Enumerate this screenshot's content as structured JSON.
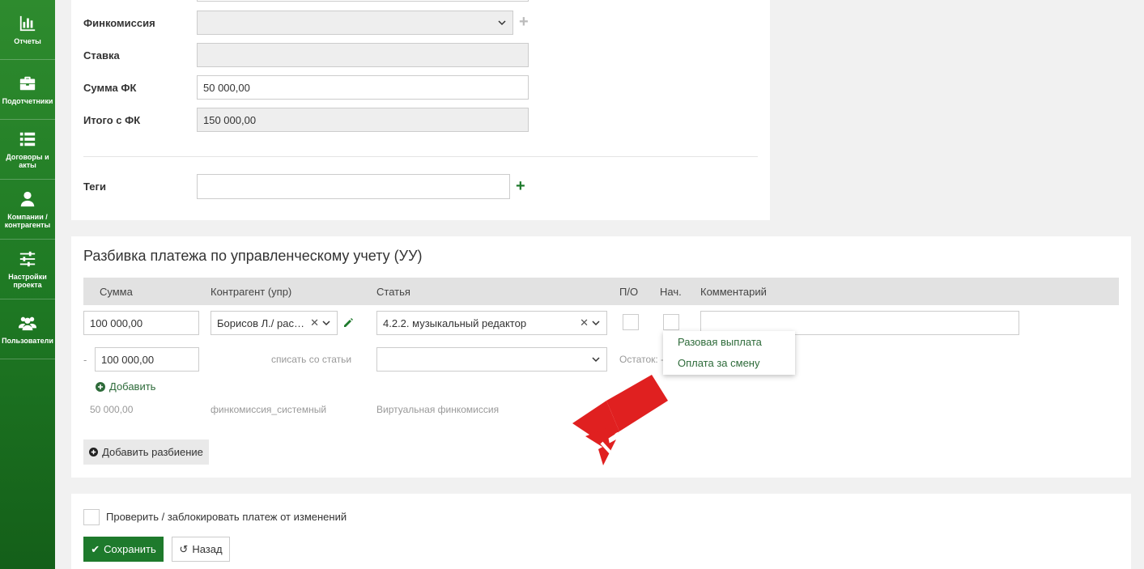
{
  "sidebar": {
    "items": [
      {
        "label": "Отчеты",
        "icon": "bar-chart-icon"
      },
      {
        "label": "Подотчетники",
        "icon": "briefcase-icon"
      },
      {
        "label": "Договоры и акты",
        "icon": "list-icon"
      },
      {
        "label": "Компании / контрагенты",
        "icon": "user-icon"
      },
      {
        "label": "Настройки проекта",
        "icon": "sliders-icon"
      },
      {
        "label": "Пользователи",
        "icon": "users-icon"
      }
    ]
  },
  "form": {
    "fincommission_label": "Финкомиссия",
    "fincommission_value": "",
    "rate_label": "Ставка",
    "rate_value": "",
    "sum_fk_label": "Сумма ФК",
    "sum_fk_value": "50 000,00",
    "total_fk_label": "Итого с ФК",
    "total_fk_value": "150 000,00",
    "tags_label": "Теги",
    "tags_value": ""
  },
  "breakdown": {
    "title": "Разбивка платежа по управленческому учету (УУ)",
    "columns": {
      "sum": "Сумма",
      "counterparty": "Контрагент (упр)",
      "article": "Статья",
      "po": "П/О",
      "nach": "Нач.",
      "comment": "Комментарий"
    },
    "row": {
      "sum": "100 000,00",
      "counterparty": "Борисов Л./ рас…",
      "article": "4.2.2. музыкальный редактор",
      "comment": ""
    },
    "sub_row": {
      "dash": "-",
      "sum": "100 000,00",
      "writeoff_label": "списать со статьи",
      "article": "",
      "remainder_label": "Остаток: -"
    },
    "add_label": "Добавить",
    "virtual_row": {
      "sum": "50 000,00",
      "counterparty": "финкомиссия_системный",
      "article": "Виртуальная финкомиссия"
    },
    "add_split_label": "Добавить разбиение"
  },
  "dropdown": {
    "items": [
      "Разовая выплата",
      "Оплата за смену"
    ]
  },
  "footer": {
    "lock_label": "Проверить / заблокировать платеж от изменений",
    "save_label": "Сохранить",
    "back_label": "Назад"
  },
  "colors": {
    "sidebar_green": "#1f7a24",
    "accent_green": "#1e7a2c",
    "arrow_red": "#e02020"
  }
}
